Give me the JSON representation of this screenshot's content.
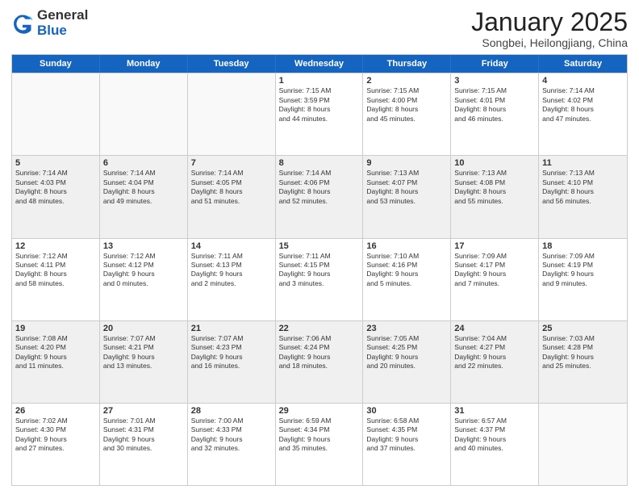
{
  "header": {
    "logo_general": "General",
    "logo_blue": "Blue",
    "month_title": "January 2025",
    "subtitle": "Songbei, Heilongjiang, China"
  },
  "weekdays": [
    "Sunday",
    "Monday",
    "Tuesday",
    "Wednesday",
    "Thursday",
    "Friday",
    "Saturday"
  ],
  "rows": [
    [
      {
        "day": "",
        "text": "",
        "empty": true
      },
      {
        "day": "",
        "text": "",
        "empty": true
      },
      {
        "day": "",
        "text": "",
        "empty": true
      },
      {
        "day": "1",
        "text": "Sunrise: 7:15 AM\nSunset: 3:59 PM\nDaylight: 8 hours\nand 44 minutes."
      },
      {
        "day": "2",
        "text": "Sunrise: 7:15 AM\nSunset: 4:00 PM\nDaylight: 8 hours\nand 45 minutes."
      },
      {
        "day": "3",
        "text": "Sunrise: 7:15 AM\nSunset: 4:01 PM\nDaylight: 8 hours\nand 46 minutes."
      },
      {
        "day": "4",
        "text": "Sunrise: 7:14 AM\nSunset: 4:02 PM\nDaylight: 8 hours\nand 47 minutes."
      }
    ],
    [
      {
        "day": "5",
        "text": "Sunrise: 7:14 AM\nSunset: 4:03 PM\nDaylight: 8 hours\nand 48 minutes.",
        "shaded": true
      },
      {
        "day": "6",
        "text": "Sunrise: 7:14 AM\nSunset: 4:04 PM\nDaylight: 8 hours\nand 49 minutes.",
        "shaded": true
      },
      {
        "day": "7",
        "text": "Sunrise: 7:14 AM\nSunset: 4:05 PM\nDaylight: 8 hours\nand 51 minutes.",
        "shaded": true
      },
      {
        "day": "8",
        "text": "Sunrise: 7:14 AM\nSunset: 4:06 PM\nDaylight: 8 hours\nand 52 minutes.",
        "shaded": true
      },
      {
        "day": "9",
        "text": "Sunrise: 7:13 AM\nSunset: 4:07 PM\nDaylight: 8 hours\nand 53 minutes.",
        "shaded": true
      },
      {
        "day": "10",
        "text": "Sunrise: 7:13 AM\nSunset: 4:08 PM\nDaylight: 8 hours\nand 55 minutes.",
        "shaded": true
      },
      {
        "day": "11",
        "text": "Sunrise: 7:13 AM\nSunset: 4:10 PM\nDaylight: 8 hours\nand 56 minutes.",
        "shaded": true
      }
    ],
    [
      {
        "day": "12",
        "text": "Sunrise: 7:12 AM\nSunset: 4:11 PM\nDaylight: 8 hours\nand 58 minutes."
      },
      {
        "day": "13",
        "text": "Sunrise: 7:12 AM\nSunset: 4:12 PM\nDaylight: 9 hours\nand 0 minutes."
      },
      {
        "day": "14",
        "text": "Sunrise: 7:11 AM\nSunset: 4:13 PM\nDaylight: 9 hours\nand 2 minutes."
      },
      {
        "day": "15",
        "text": "Sunrise: 7:11 AM\nSunset: 4:15 PM\nDaylight: 9 hours\nand 3 minutes."
      },
      {
        "day": "16",
        "text": "Sunrise: 7:10 AM\nSunset: 4:16 PM\nDaylight: 9 hours\nand 5 minutes."
      },
      {
        "day": "17",
        "text": "Sunrise: 7:09 AM\nSunset: 4:17 PM\nDaylight: 9 hours\nand 7 minutes."
      },
      {
        "day": "18",
        "text": "Sunrise: 7:09 AM\nSunset: 4:19 PM\nDaylight: 9 hours\nand 9 minutes."
      }
    ],
    [
      {
        "day": "19",
        "text": "Sunrise: 7:08 AM\nSunset: 4:20 PM\nDaylight: 9 hours\nand 11 minutes.",
        "shaded": true
      },
      {
        "day": "20",
        "text": "Sunrise: 7:07 AM\nSunset: 4:21 PM\nDaylight: 9 hours\nand 13 minutes.",
        "shaded": true
      },
      {
        "day": "21",
        "text": "Sunrise: 7:07 AM\nSunset: 4:23 PM\nDaylight: 9 hours\nand 16 minutes.",
        "shaded": true
      },
      {
        "day": "22",
        "text": "Sunrise: 7:06 AM\nSunset: 4:24 PM\nDaylight: 9 hours\nand 18 minutes.",
        "shaded": true
      },
      {
        "day": "23",
        "text": "Sunrise: 7:05 AM\nSunset: 4:25 PM\nDaylight: 9 hours\nand 20 minutes.",
        "shaded": true
      },
      {
        "day": "24",
        "text": "Sunrise: 7:04 AM\nSunset: 4:27 PM\nDaylight: 9 hours\nand 22 minutes.",
        "shaded": true
      },
      {
        "day": "25",
        "text": "Sunrise: 7:03 AM\nSunset: 4:28 PM\nDaylight: 9 hours\nand 25 minutes.",
        "shaded": true
      }
    ],
    [
      {
        "day": "26",
        "text": "Sunrise: 7:02 AM\nSunset: 4:30 PM\nDaylight: 9 hours\nand 27 minutes."
      },
      {
        "day": "27",
        "text": "Sunrise: 7:01 AM\nSunset: 4:31 PM\nDaylight: 9 hours\nand 30 minutes."
      },
      {
        "day": "28",
        "text": "Sunrise: 7:00 AM\nSunset: 4:33 PM\nDaylight: 9 hours\nand 32 minutes."
      },
      {
        "day": "29",
        "text": "Sunrise: 6:59 AM\nSunset: 4:34 PM\nDaylight: 9 hours\nand 35 minutes."
      },
      {
        "day": "30",
        "text": "Sunrise: 6:58 AM\nSunset: 4:35 PM\nDaylight: 9 hours\nand 37 minutes."
      },
      {
        "day": "31",
        "text": "Sunrise: 6:57 AM\nSunset: 4:37 PM\nDaylight: 9 hours\nand 40 minutes."
      },
      {
        "day": "",
        "text": "",
        "empty": true
      }
    ]
  ]
}
